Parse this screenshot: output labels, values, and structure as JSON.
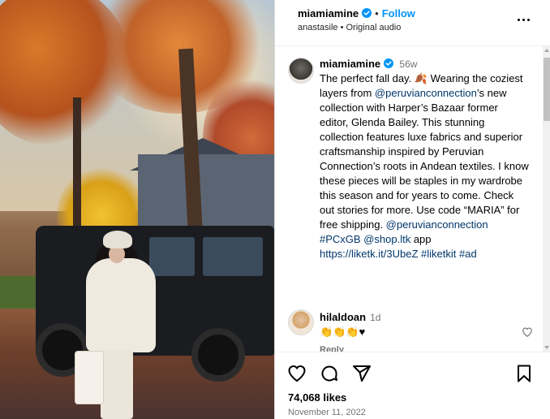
{
  "post": {
    "author": "miamiamine",
    "follow_label": "Follow",
    "dot": "•",
    "audio_line": "anastasile • Original audio",
    "verified_icon": "verified-badge-icon",
    "more_icon": "more-options-icon"
  },
  "caption": {
    "username": "miamiamine",
    "time": "56w",
    "text_1": "The perfect fall day. 🍂 Wearing the coziest layers from ",
    "mention_1": "@peruvianconnection",
    "text_2": "’s new collection with Harper’s Bazaar former editor, Glenda Bailey. This stunning collection features luxe fabrics and superior craftsmanship inspired by Peruvian Connection’s roots in Andean textiles. I know these pieces will be staples in my wardrobe this season and for years to come. Check out stories for more. Use code “MARIA” for free shipping. ",
    "mention_2": "@peruvianconnection",
    "tag_1": "#PCxGB",
    "mention_3": "@shop.ltk",
    "text_3": " app ",
    "link_1": "https://liketk.it/3UbeZ",
    "tag_2": "#liketkit",
    "tag_3": "#ad"
  },
  "comment": {
    "username": "hilaldoan",
    "time": "1d",
    "text": "👏👏👏♥",
    "reply_label": "Reply"
  },
  "footer": {
    "likes": "74,068 likes",
    "date": "November 11, 2022"
  },
  "colors": {
    "accent": "#0095f6",
    "link": "#00376b",
    "muted": "#737373"
  }
}
